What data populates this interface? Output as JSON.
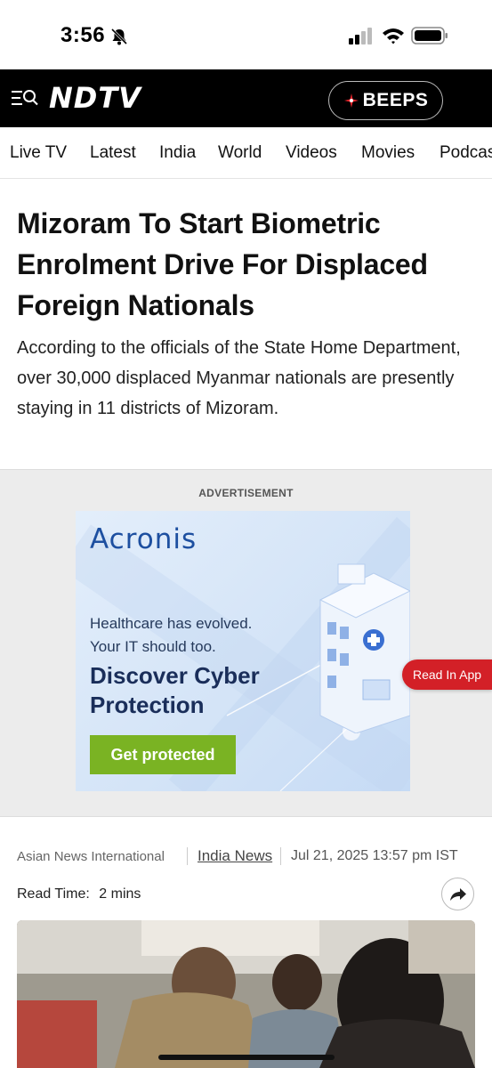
{
  "status_bar": {
    "time": "3:56",
    "icons": [
      "bell-slash-icon",
      "cellular-signal-icon",
      "wifi-icon",
      "battery-icon"
    ]
  },
  "header": {
    "logo": "NDTV",
    "beeps_label": "BEEPS",
    "icons": [
      "menu-search-icon",
      "beeps-icon"
    ],
    "background_color": "#000000",
    "accent_color": "#d32027"
  },
  "nav": {
    "items": [
      "Live TV",
      "Latest",
      "India",
      "World",
      "Videos",
      "Movies",
      "Podcas"
    ]
  },
  "article": {
    "headline": "Mizoram To Start Biometric Enrolment Drive For Displaced Foreign Nationals",
    "summary": "According to the officials of the State Home Department, over 30,000 displaced Myanmar nationals are presently staying in 11 districts of Mizoram.",
    "source": "Asian News International",
    "category": "India News",
    "date": "Jul 21, 2025 13:57 pm IST",
    "read_time_label": "Read Time:",
    "read_time_value": "2 mins"
  },
  "ad": {
    "label": "ADVERTISEMENT",
    "brand": "Acronis",
    "line1": "Healthcare has evolved.",
    "line2": "Your IT should too.",
    "heading1": "Discover Cyber",
    "heading2": "Protection",
    "cta": "Get protected",
    "cta_color": "#7ab323"
  },
  "floating": {
    "read_in_app": "Read In App"
  }
}
